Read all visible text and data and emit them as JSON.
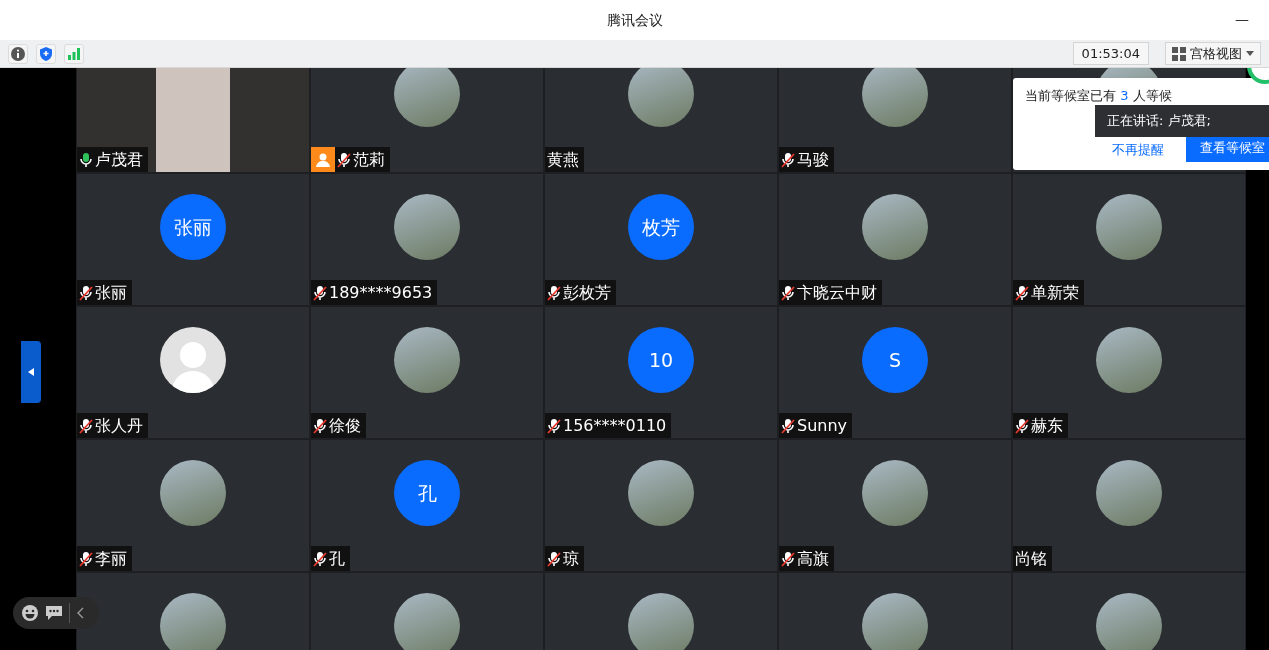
{
  "window": {
    "title": "腾讯会议",
    "minimize": "—"
  },
  "toolbar": {
    "timer": "01:53:04",
    "view_button": "宫格视图"
  },
  "tiles": [
    {
      "name": "卢茂君",
      "mic_icon": true,
      "muted": false,
      "kind": "video",
      "host": false
    },
    {
      "name": "范莉",
      "mic_icon": true,
      "muted": true,
      "kind": "photo",
      "host": true
    },
    {
      "name": "黄燕",
      "mic_icon": false,
      "kind": "photo",
      "host": false
    },
    {
      "name": "马骏",
      "mic_icon": true,
      "muted": true,
      "kind": "photo",
      "host": false
    },
    {
      "kind": "photo"
    },
    {
      "name": "张丽",
      "mic_icon": true,
      "muted": true,
      "kind": "initials",
      "initials": "张丽",
      "host": false
    },
    {
      "name": "189****9653",
      "mic_icon": true,
      "muted": true,
      "kind": "photo",
      "host": false
    },
    {
      "name": "彭枚芳",
      "mic_icon": true,
      "muted": true,
      "kind": "initials",
      "initials": "枚芳",
      "host": false
    },
    {
      "name": "卞晓云中财",
      "mic_icon": true,
      "muted": true,
      "kind": "photo",
      "host": false
    },
    {
      "name": "单新荣",
      "mic_icon": true,
      "muted": true,
      "kind": "photo",
      "host": false
    },
    {
      "name": "张人丹",
      "mic_icon": true,
      "muted": true,
      "kind": "default",
      "host": false
    },
    {
      "name": "徐俊",
      "mic_icon": true,
      "muted": true,
      "kind": "photo",
      "host": false
    },
    {
      "name": "156****0110",
      "mic_icon": true,
      "muted": true,
      "kind": "initials",
      "initials": "10",
      "host": false
    },
    {
      "name": "Sunny",
      "mic_icon": true,
      "muted": true,
      "kind": "initials",
      "initials": "S",
      "host": false
    },
    {
      "name": "赫东",
      "mic_icon": true,
      "muted": true,
      "kind": "photo",
      "host": false
    },
    {
      "name": "李丽",
      "mic_icon": true,
      "muted": true,
      "kind": "photo",
      "host": false
    },
    {
      "name": "孔",
      "mic_icon": true,
      "muted": true,
      "kind": "initials",
      "initials": "孔",
      "host": false
    },
    {
      "name": "琼",
      "mic_icon": true,
      "muted": true,
      "kind": "photo",
      "host": false
    },
    {
      "name": "高旗",
      "mic_icon": true,
      "muted": true,
      "kind": "photo",
      "host": false
    },
    {
      "name": "尚铭",
      "mic_icon": false,
      "kind": "photo",
      "host": false
    },
    {
      "kind": "photo"
    },
    {
      "kind": "photo"
    },
    {
      "kind": "photo"
    },
    {
      "kind": "photo"
    },
    {
      "kind": "photo"
    }
  ],
  "waiting_popup": {
    "text_before": "当前等候室已有",
    "count": "3",
    "text_after": "人等候",
    "dismiss_link": "不再提醒",
    "view_button": "查看等候室"
  },
  "speaking_tooltip": "正在讲话: 卢茂君;"
}
